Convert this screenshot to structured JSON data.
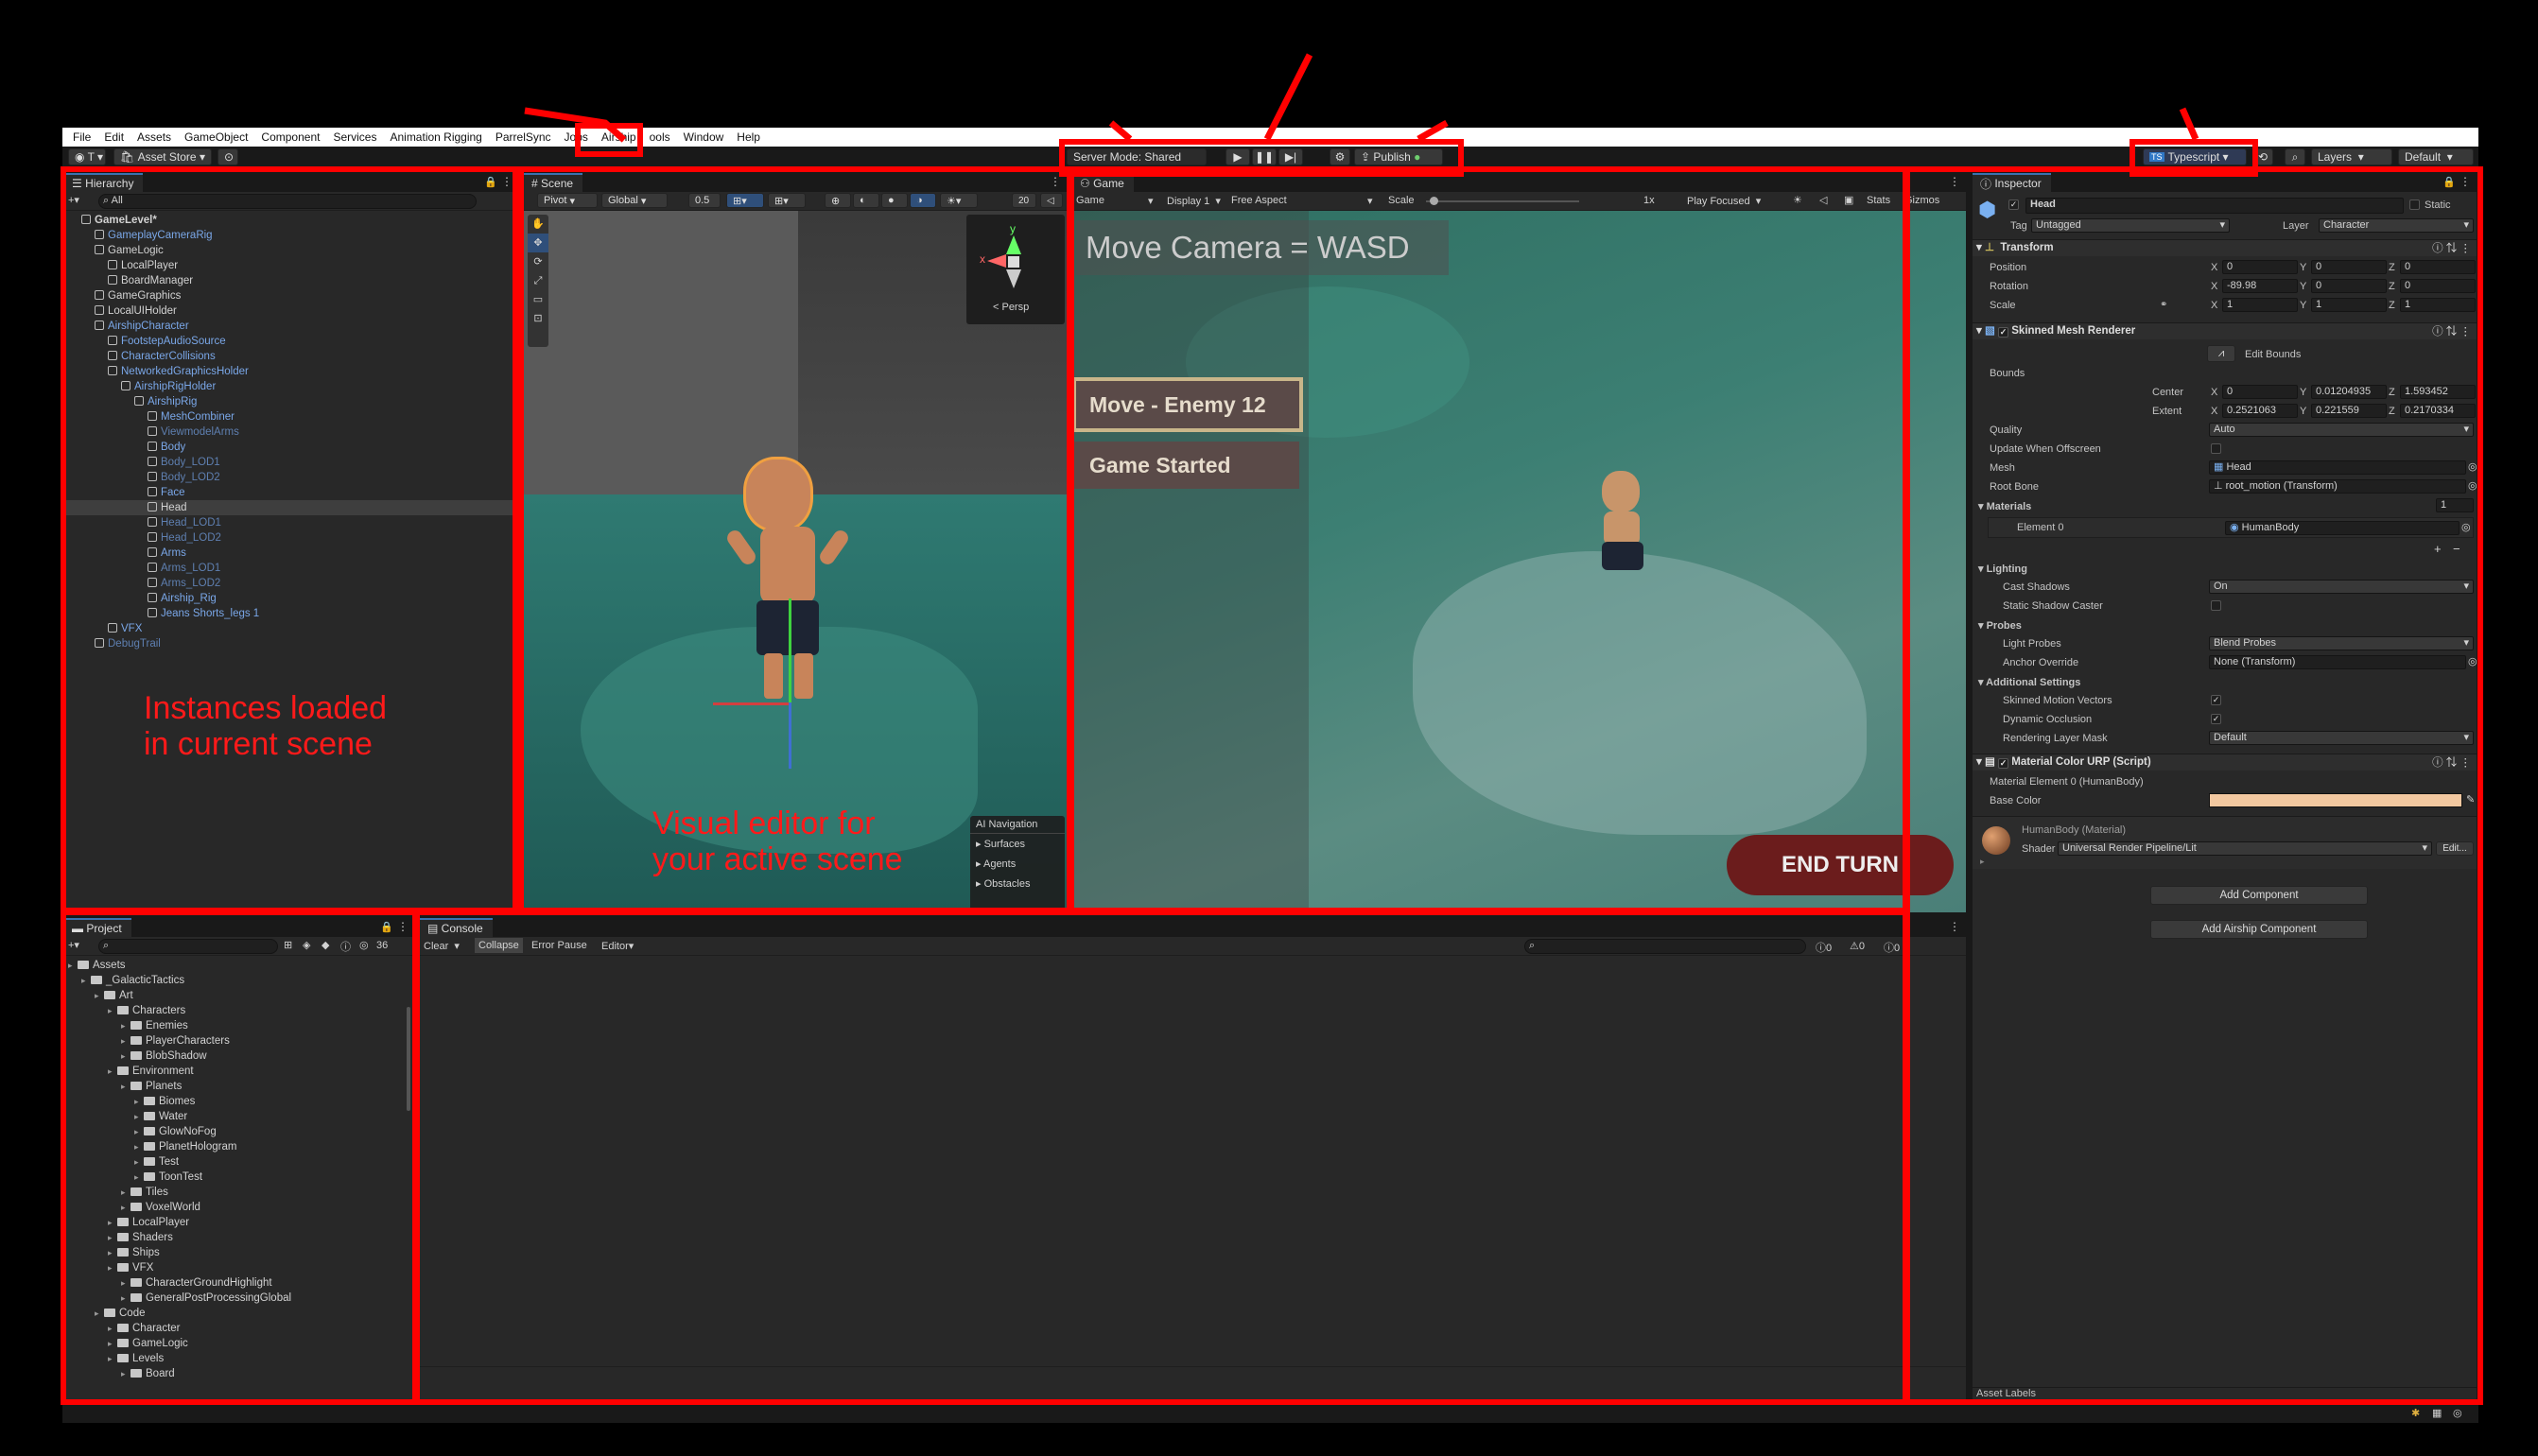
{
  "menu": [
    "File",
    "Edit",
    "Assets",
    "GameObject",
    "Component",
    "Services",
    "Animation Rigging",
    "ParrelSync",
    "Jobs",
    "Airship",
    "ools",
    "Window",
    "Help"
  ],
  "toolbar": {
    "asset_store": "Asset Store",
    "server_mode": "Server Mode: Shared",
    "publish": "Publish",
    "typescript": "Typescript",
    "layers": "Layers",
    "layout": "Default"
  },
  "hierarchy": {
    "tab": "Hierarchy",
    "search": "All",
    "items": [
      {
        "label": "GameLevel*",
        "depth": 0,
        "style": "bold"
      },
      {
        "label": "GameplayCameraRig",
        "depth": 1,
        "style": "blue"
      },
      {
        "label": "GameLogic",
        "depth": 1,
        "style": "normal"
      },
      {
        "label": "LocalPlayer",
        "depth": 2,
        "style": "normal"
      },
      {
        "label": "BoardManager",
        "depth": 2,
        "style": "normal"
      },
      {
        "label": "GameGraphics",
        "depth": 1,
        "style": "normal"
      },
      {
        "label": "LocalUIHolder",
        "depth": 1,
        "style": "normal"
      },
      {
        "label": "AirshipCharacter",
        "depth": 1,
        "style": "blue"
      },
      {
        "label": "FootstepAudioSource",
        "depth": 2,
        "style": "blue"
      },
      {
        "label": "CharacterCollisions",
        "depth": 2,
        "style": "blue"
      },
      {
        "label": "NetworkedGraphicsHolder",
        "depth": 2,
        "style": "blue"
      },
      {
        "label": "AirshipRigHolder",
        "depth": 3,
        "style": "blue"
      },
      {
        "label": "AirshipRig",
        "depth": 4,
        "style": "blue"
      },
      {
        "label": "MeshCombiner",
        "depth": 5,
        "style": "blue"
      },
      {
        "label": "ViewmodelArms",
        "depth": 5,
        "style": "dim"
      },
      {
        "label": "Body",
        "depth": 5,
        "style": "blue"
      },
      {
        "label": "Body_LOD1",
        "depth": 5,
        "style": "dim"
      },
      {
        "label": "Body_LOD2",
        "depth": 5,
        "style": "dim"
      },
      {
        "label": "Face",
        "depth": 5,
        "style": "blue"
      },
      {
        "label": "Head",
        "depth": 5,
        "style": "selected"
      },
      {
        "label": "Head_LOD1",
        "depth": 5,
        "style": "dim"
      },
      {
        "label": "Head_LOD2",
        "depth": 5,
        "style": "dim"
      },
      {
        "label": "Arms",
        "depth": 5,
        "style": "blue"
      },
      {
        "label": "Arms_LOD1",
        "depth": 5,
        "style": "dim"
      },
      {
        "label": "Arms_LOD2",
        "depth": 5,
        "style": "dim"
      },
      {
        "label": "Airship_Rig",
        "depth": 5,
        "style": "blue"
      },
      {
        "label": "Jeans Shorts_legs 1",
        "depth": 5,
        "style": "blue"
      },
      {
        "label": "VFX",
        "depth": 2,
        "style": "blue"
      },
      {
        "label": "DebugTrail",
        "depth": 1,
        "style": "dim"
      }
    ]
  },
  "scene": {
    "tab": "Scene",
    "pivot": "Pivot",
    "global": "Global",
    "snap": "0.5",
    "grid": "20",
    "persp": "< Persp",
    "ai_nav": {
      "title": "AI Navigation",
      "items": [
        "Surfaces",
        "Agents",
        "Obstacles"
      ]
    }
  },
  "game": {
    "tab": "Game",
    "mode": "Game",
    "display": "Display 1",
    "aspect": "Free Aspect",
    "scale_label": "Scale",
    "scale_value": "1x",
    "play": "Play Focused",
    "stats": "Stats",
    "gizmos": "Gizmos",
    "hud_text": "Move Camera = WASD",
    "btn_move": "Move - Enemy 12",
    "btn_started": "Game Started",
    "end_turn": "END TURN"
  },
  "project": {
    "tab": "Project",
    "count": "36",
    "items": [
      {
        "label": "Assets",
        "depth": 0
      },
      {
        "label": "_GalacticTactics",
        "depth": 1
      },
      {
        "label": "Art",
        "depth": 2
      },
      {
        "label": "Characters",
        "depth": 3
      },
      {
        "label": "Enemies",
        "depth": 4
      },
      {
        "label": "PlayerCharacters",
        "depth": 4
      },
      {
        "label": "BlobShadow",
        "depth": 4
      },
      {
        "label": "Environment",
        "depth": 3
      },
      {
        "label": "Planets",
        "depth": 4
      },
      {
        "label": "Biomes",
        "depth": 5
      },
      {
        "label": "Water",
        "depth": 5
      },
      {
        "label": "GlowNoFog",
        "depth": 5
      },
      {
        "label": "PlanetHologram",
        "depth": 5
      },
      {
        "label": "Test",
        "depth": 5
      },
      {
        "label": "ToonTest",
        "depth": 5
      },
      {
        "label": "Tiles",
        "depth": 4
      },
      {
        "label": "VoxelWorld",
        "depth": 4
      },
      {
        "label": "LocalPlayer",
        "depth": 3
      },
      {
        "label": "Shaders",
        "depth": 3
      },
      {
        "label": "Ships",
        "depth": 3
      },
      {
        "label": "VFX",
        "depth": 3
      },
      {
        "label": "CharacterGroundHighlight",
        "depth": 4
      },
      {
        "label": "GeneralPostProcessingGlobal",
        "depth": 4
      },
      {
        "label": "Code",
        "depth": 2
      },
      {
        "label": "Character",
        "depth": 3
      },
      {
        "label": "GameLogic",
        "depth": 3
      },
      {
        "label": "Levels",
        "depth": 3
      },
      {
        "label": "Board",
        "depth": 4
      }
    ]
  },
  "console": {
    "tab": "Console",
    "clear": "Clear",
    "collapse": "Collapse",
    "error_pause": "Error Pause",
    "editor": "Editor",
    "c1": "0",
    "c2": "0",
    "c3": "0"
  },
  "inspector": {
    "tab": "Inspector",
    "name": "Head",
    "static": "Static",
    "tag_label": "Tag",
    "tag": "Untagged",
    "layer_label": "Layer",
    "layer": "Character",
    "transform": {
      "title": "Transform",
      "position": "Position",
      "rotation": "Rotation",
      "scale": "Scale",
      "pos": [
        "0",
        "0",
        "0"
      ],
      "rot": [
        "-89.98",
        "0",
        "0"
      ],
      "scl": [
        "1",
        "1",
        "1"
      ]
    },
    "smr": {
      "title": "Skinned Mesh Renderer",
      "edit_bounds": "Edit Bounds",
      "bounds": "Bounds",
      "center": "Center",
      "extent": "Extent",
      "center_v": [
        "0",
        "0.01204935",
        "1.593452"
      ],
      "extent_v": [
        "0.2521063",
        "0.221559",
        "0.2170334"
      ],
      "quality": "Quality",
      "quality_v": "Auto",
      "update": "Update When Offscreen",
      "mesh": "Mesh",
      "mesh_v": "Head",
      "root_bone": "Root Bone",
      "root_bone_v": "root_motion (Transform)",
      "materials": "Materials",
      "materials_count": "1",
      "element0": "Element 0",
      "element0_v": "HumanBody",
      "lighting": "Lighting",
      "cast": "Cast Shadows",
      "cast_v": "On",
      "static_shadow": "Static Shadow Caster",
      "probes": "Probes",
      "light_probes": "Light Probes",
      "light_probes_v": "Blend Probes",
      "anchor": "Anchor Override",
      "anchor_v": "None (Transform)",
      "additional": "Additional Settings",
      "motion": "Skinned Motion Vectors",
      "occlusion": "Dynamic Occlusion",
      "rlm": "Rendering Layer Mask",
      "rlm_v": "Default"
    },
    "mcurp": {
      "title": "Material Color URP (Script)",
      "elem": "Material Element 0 (HumanBody)",
      "base": "Base Color",
      "color": "#f2c8a0"
    },
    "material": {
      "title": "HumanBody (Material)",
      "shader_label": "Shader",
      "shader": "Universal Render Pipeline/Lit",
      "edit": "Edit..."
    },
    "add_component": "Add Component",
    "add_airship": "Add Airship Component",
    "asset_labels": "Asset Labels"
  },
  "annotations": {
    "hierarchy": "Instances loaded\nin current scene",
    "scene": "Visual editor for\nyour active scene"
  },
  "colors": {
    "annotation": "#ff0000",
    "selection": "#2c5d87",
    "button_dark": "#6b1c1c"
  }
}
